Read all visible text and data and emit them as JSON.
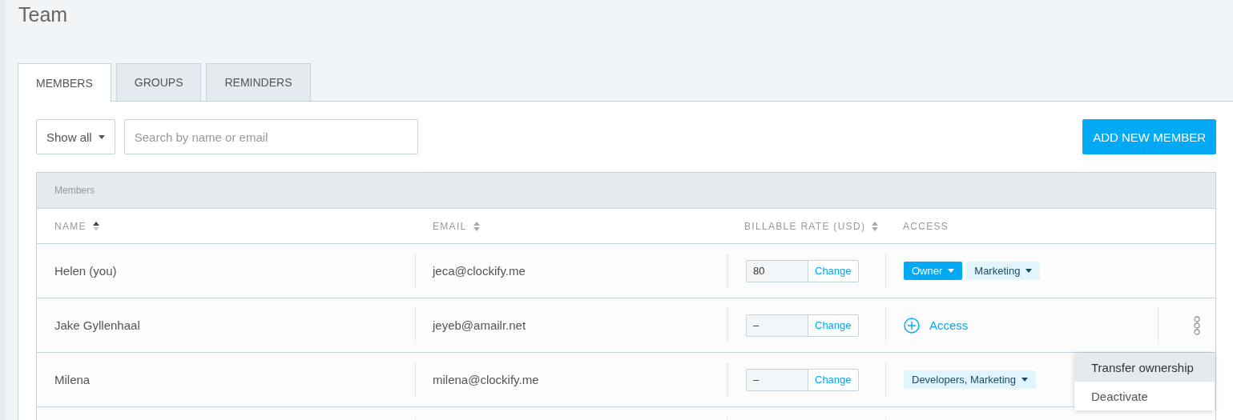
{
  "page_title": "Team",
  "tabs": [
    {
      "label": "MEMBERS",
      "selected": true
    },
    {
      "label": "GROUPS",
      "selected": false
    },
    {
      "label": "REMINDERS",
      "selected": false
    }
  ],
  "filter": {
    "value": "Show all"
  },
  "search": {
    "placeholder": "Search by name or email"
  },
  "add_button": "ADD NEW MEMBER",
  "table": {
    "title": "Members",
    "columns": [
      {
        "label": "NAME",
        "sortable": true,
        "sorted": true
      },
      {
        "label": "EMAIL",
        "sortable": true,
        "sorted": false
      },
      {
        "label": "BILLABLE RATE (USD)",
        "sortable": true,
        "sorted": false
      },
      {
        "label": "ACCESS"
      }
    ],
    "rows": [
      {
        "name": "Helen (you)",
        "email": "jeca@clockify.me",
        "rate": "80",
        "change": "Change",
        "access": [
          {
            "kind": "role",
            "label": "Owner"
          },
          {
            "kind": "group",
            "label": "Marketing"
          }
        ]
      },
      {
        "name": "Jake Gyllenhaal",
        "email": "jeyeb@amailr.net",
        "rate": "–",
        "change": "Change",
        "access": [
          {
            "kind": "add",
            "label": "Access"
          }
        ],
        "menu_visible": true
      },
      {
        "name": "Milena",
        "email": "milena@clockify.me",
        "rate": "–",
        "change": "Change",
        "access": [
          {
            "kind": "group",
            "label": "Developers, Marketing"
          }
        ]
      }
    ]
  },
  "row_menu": [
    {
      "label": "Transfer ownership",
      "selected": true
    },
    {
      "label": "Deactivate",
      "selected": false
    }
  ]
}
